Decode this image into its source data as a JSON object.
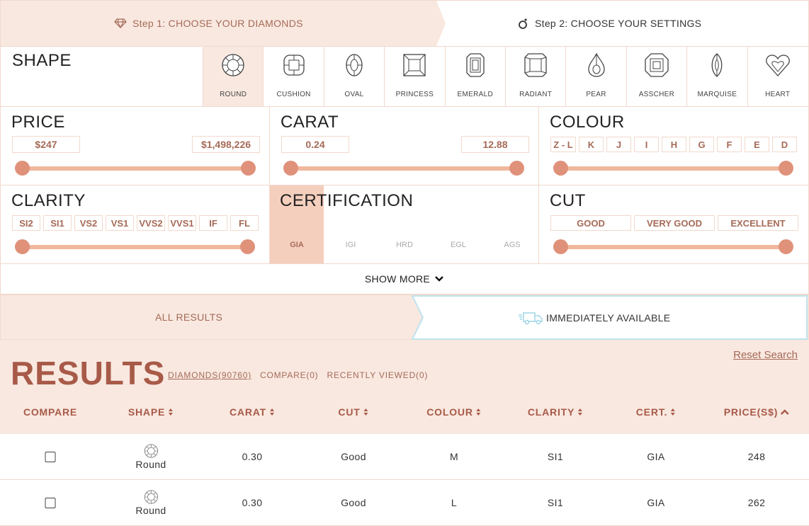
{
  "steps": {
    "step1": "Step 1: CHOOSE YOUR DIAMONDS",
    "step2": "Step 2: CHOOSE YOUR SETTINGS"
  },
  "shape": {
    "title": "SHAPE",
    "items": [
      {
        "label": "ROUND",
        "icon": "round-diamond-icon",
        "active": true
      },
      {
        "label": "CUSHION",
        "icon": "cushion-diamond-icon"
      },
      {
        "label": "OVAL",
        "icon": "oval-diamond-icon"
      },
      {
        "label": "PRINCESS",
        "icon": "princess-diamond-icon"
      },
      {
        "label": "EMERALD",
        "icon": "emerald-diamond-icon"
      },
      {
        "label": "RADIANT",
        "icon": "radiant-diamond-icon"
      },
      {
        "label": "PEAR",
        "icon": "pear-diamond-icon"
      },
      {
        "label": "ASSCHER",
        "icon": "asscher-diamond-icon"
      },
      {
        "label": "MARQUISE",
        "icon": "marquise-diamond-icon"
      },
      {
        "label": "HEART",
        "icon": "heart-diamond-icon"
      }
    ]
  },
  "price": {
    "title": "PRICE",
    "min": "$247",
    "max": "$1,498,226"
  },
  "carat": {
    "title": "CARAT",
    "min": "0.24",
    "max": "12.88"
  },
  "colour": {
    "title": "COLOUR",
    "options": [
      "Z - L",
      "K",
      "J",
      "I",
      "H",
      "G",
      "F",
      "E",
      "D"
    ]
  },
  "clarity": {
    "title": "CLARITY",
    "options": [
      "SI2",
      "SI1",
      "VS2",
      "VS1",
      "VVS2",
      "VVS1",
      "IF",
      "FL"
    ]
  },
  "certification": {
    "title": "CERTIFICATION",
    "options": [
      "GIA",
      "IGI",
      "HRD",
      "EGL",
      "AGS"
    ],
    "selected": "GIA"
  },
  "cut": {
    "title": "CUT",
    "options": [
      "GOOD",
      "VERY GOOD",
      "EXCELLENT"
    ]
  },
  "show_more": "SHOW MORE",
  "availability": {
    "all": "ALL RESULTS",
    "immediate": "IMMEDIATELY AVAILABLE"
  },
  "results": {
    "title": "RESULTS",
    "diamonds": "DIAMONDS(90760)",
    "compare": "COMPARE(0)",
    "recent": "RECENTLY VIEWED(0)",
    "reset": "Reset Search",
    "columns": [
      "COMPARE",
      "SHAPE",
      "CARAT",
      "CUT",
      "COLOUR",
      "CLARITY",
      "CERT.",
      "PRICE(S$)"
    ],
    "rows": [
      {
        "shape": "Round",
        "carat": "0.30",
        "cut": "Good",
        "colour": "M",
        "clarity": "SI1",
        "cert": "GIA",
        "price": "248"
      },
      {
        "shape": "Round",
        "carat": "0.30",
        "cut": "Good",
        "colour": "L",
        "clarity": "SI1",
        "cert": "GIA",
        "price": "262"
      }
    ]
  },
  "colors": {
    "accent": "#a66a57",
    "peach": "#f8e8e0",
    "slider": "#f0b79c",
    "thumb": "#e0917a"
  }
}
